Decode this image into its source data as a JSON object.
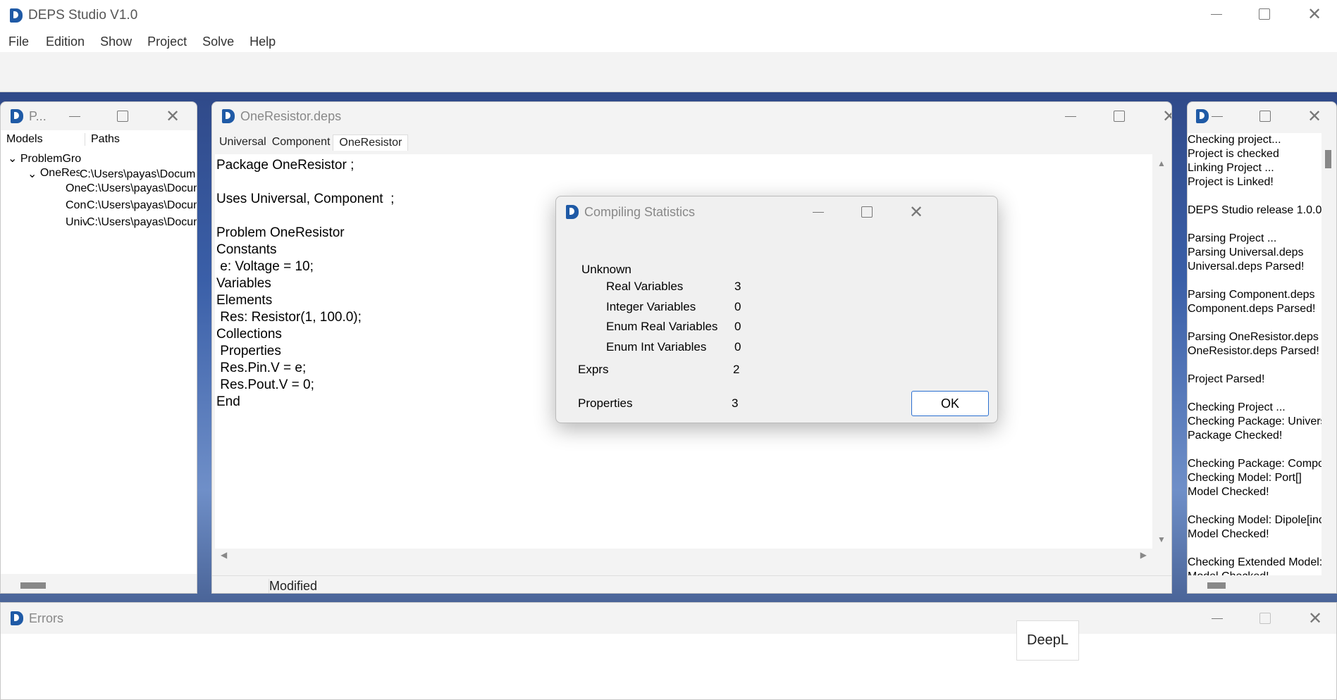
{
  "main": {
    "title": "DEPS Studio V1.0",
    "menu": [
      "File",
      "Edition",
      "Show",
      "Project",
      "Solve",
      "Help"
    ]
  },
  "project": {
    "title": "P...",
    "columns": [
      "Models",
      "Paths"
    ],
    "tree": [
      {
        "name": "ProblemGro",
        "path": ""
      },
      {
        "name": "OneRes",
        "path": "C:\\Users\\payas\\Docum"
      },
      {
        "name": "One",
        "path": "C:\\Users\\payas\\Docum"
      },
      {
        "name": "Con",
        "path": "C:\\Users\\payas\\Docum"
      },
      {
        "name": "Univ",
        "path": "C:\\Users\\payas\\Docum"
      }
    ]
  },
  "editor": {
    "title": "OneResistor.deps",
    "tabs": [
      "Universal",
      "Component",
      "OneResistor"
    ],
    "active_tab": "OneResistor",
    "lines": [
      "Package OneResistor ;",
      "",
      "Uses Universal, Component  ;",
      "",
      "Problem OneResistor",
      "Constants",
      " e: Voltage = 10;",
      "Variables",
      "Elements",
      " Res: Resistor(1, 100.0);",
      "Collections",
      " Properties",
      " Res.Pin.V = e;",
      " Res.Pout.V = 0;",
      "End"
    ],
    "status": "Modified"
  },
  "dialog": {
    "title": "Compiling Statistics",
    "unknown_label": "Unknown",
    "rows": [
      {
        "label": "Real Variables",
        "value": "3"
      },
      {
        "label": "Integer Variables",
        "value": "0"
      },
      {
        "label": "Enum Real Variables",
        "value": "0"
      },
      {
        "label": "Enum Int Variables",
        "value": "0"
      }
    ],
    "exprs_label": "Exprs",
    "exprs_value": "2",
    "properties_label": "Properties",
    "properties_value": "3",
    "ok": "OK"
  },
  "console": {
    "lines": [
      "Checking project...",
      "Project is checked",
      "Linking Project ...",
      "Project is Linked!",
      "",
      "DEPS Studio release 1.0.0",
      "",
      "Parsing Project ...",
      "Parsing Universal.deps",
      "Universal.deps Parsed!",
      "",
      "Parsing Component.deps",
      "Component.deps Parsed!",
      "",
      "Parsing OneResistor.deps",
      "OneResistor.deps Parsed!",
      "",
      "Project Parsed!",
      "",
      "Checking Project ...",
      "Checking Package: Univers",
      "Package Checked!",
      "",
      "Checking Package: Compo",
      "Checking Model: Port[]",
      "Model Checked!",
      "",
      "Checking Model: Dipole[inc",
      "Model Checked!",
      "",
      "Checking Extended Model:",
      "Model Checked!"
    ]
  },
  "errors": {
    "title": "Errors"
  },
  "deepl": {
    "label": "DeepL"
  }
}
